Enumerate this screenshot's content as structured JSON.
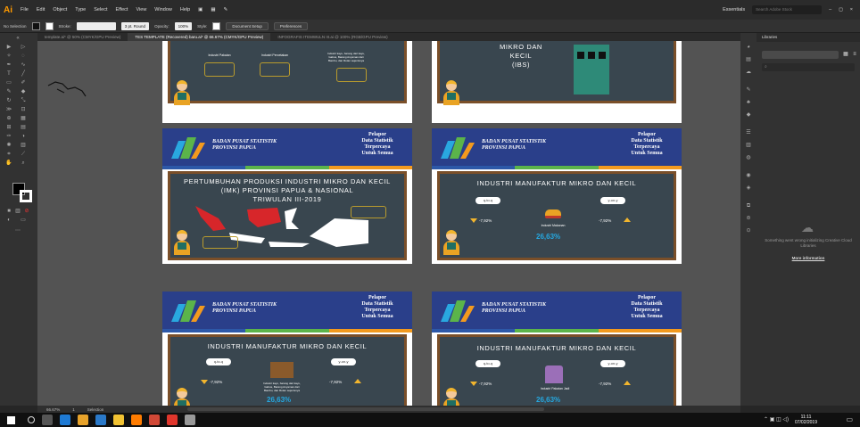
{
  "app": {
    "logo": "Ai",
    "menu": [
      "File",
      "Edit",
      "Object",
      "Type",
      "Select",
      "Effect",
      "View",
      "Window",
      "Help"
    ],
    "workspace": "Essentials",
    "search_placeholder": "Search Adobe Stock",
    "window_controls": [
      "–",
      "◻",
      "×"
    ]
  },
  "control": {
    "selection": "No Selection",
    "stroke_label": "Stroke:",
    "brush": "3 pt. Round",
    "opacity_label": "Opacity:",
    "opacity": "100%",
    "style_label": "Style:",
    "doc_setup": "Document Setup",
    "prefs": "Preferences"
  },
  "tabs": [
    "template.ai* @ 50% (CMYK/GPU Preview)",
    "TES TEMPLATE (Recovered) baru.ai* @ 66.67% (CMYK/GPU Preview)",
    "INFOGRAFIS ITEMWULN III.ai @ 100% (RGB/GPU Preview)"
  ],
  "artboards": {
    "bps_name": "BADAN PUSAT STATISTIK PROVINSI PAPUA",
    "bps_name_l1": "BADAN PUSAT STATISTIK",
    "bps_name_l2": "PROVINSI PAPUA",
    "tagline_l1": "Pelapor",
    "tagline_l2": "Data Statistik",
    "tagline_l3": "Terpercaya",
    "tagline_l4": "Untuk Semua",
    "top_right_title_l1": "MIKRO DAN",
    "top_right_title_l2": "KECIL",
    "top_right_title_l3": "(IBS)",
    "top_left_labels": [
      "Industri Pakaian",
      "Industri Percetakan",
      "Industri kayu, barang dari kayu, Gabus, Barang Anyaman dari Bambu, dan Rotan sejenisnya"
    ],
    "title_map_l1": "PERTUMBUHAN PRODUKSI INDUSTRI MIKRO DAN KECIL",
    "title_map_l2": "(IMK) PROVINSI PAPUA & NASIONAL",
    "title_map_l3": "TRIWULAN III-2019",
    "title_mfg": "INDUSTRI MANUFAKTUR MIKRO DAN KECIL",
    "qtoq": "q-to-q",
    "ytoy": "y-on-y",
    "pct_down": "-7,92%",
    "pct_up": "-7,92%",
    "big_pct": "26,63%",
    "ind_food": "Industri Makanan",
    "ind_wood": "Industri kayu, barang dari kayu, Gabus, Barang Anyaman dari Bambu, dan Rotan sejenisnya",
    "ind_cloth": "Industri Pakaian Jadi"
  },
  "libraries": {
    "title": "Libraries",
    "error": "Something went wrong initializing Creative Cloud Libraries",
    "link": "More information"
  },
  "status": {
    "zoom": "66.67%",
    "page": "1",
    "tool": "Selection"
  },
  "taskbar": {
    "time": "11:11",
    "date": "07/02/2019"
  },
  "colors": {
    "brand_blue": "#2a3f8a",
    "board": "#39464f",
    "frame": "#7a4f29",
    "accent_orange": "#ff9a00",
    "highlight": "#25a8e0"
  }
}
